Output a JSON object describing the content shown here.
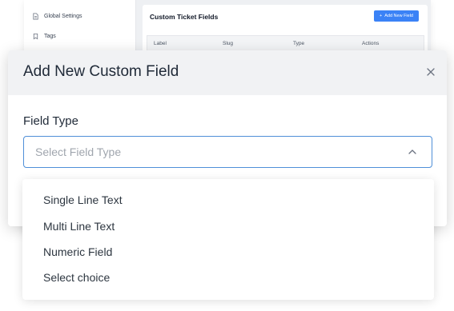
{
  "background": {
    "sidebar": {
      "items": [
        {
          "label": "Global Settings",
          "icon": "document-icon"
        },
        {
          "label": "Tags",
          "icon": "tag-icon"
        }
      ]
    },
    "panel": {
      "title": "Custom Ticket Fields",
      "add_button_label": "Add New Field",
      "columns": [
        "Label",
        "Slug",
        "Type",
        "Actions"
      ]
    },
    "accent_color": "#3b82f6"
  },
  "modal": {
    "title": "Add New Custom Field",
    "close_icon": "close-icon",
    "field_label": "Field Type",
    "select": {
      "placeholder": "Select Field Type",
      "expanded": true,
      "focus_color": "#4f8fd8"
    },
    "options": [
      "Single Line Text",
      "Multi Line Text",
      "Numeric Field",
      "Select choice"
    ]
  }
}
